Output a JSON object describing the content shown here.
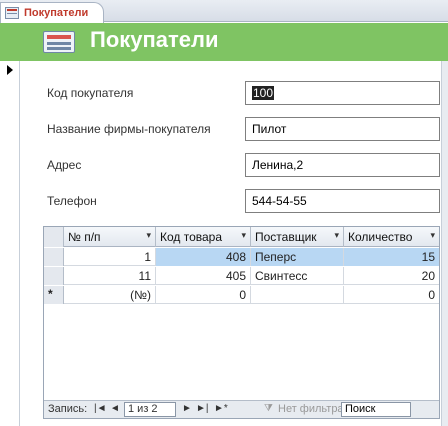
{
  "tab": {
    "label": "Покупатели",
    "icon": "form-icon"
  },
  "header": {
    "title": "Покупатели",
    "icon": "form-icon"
  },
  "fields": [
    {
      "label": "Код покупателя",
      "value": "100"
    },
    {
      "label": "Название фирмы-покупателя",
      "value": "Пилот"
    },
    {
      "label": "Адрес",
      "value": "Ленина,2"
    },
    {
      "label": "Телефон",
      "value": "544-54-55"
    }
  ],
  "subform": {
    "columns": [
      "№ п/п",
      "Код товара",
      "Поставщик",
      "Количество"
    ],
    "rows": [
      {
        "num": "1",
        "code": "408",
        "supplier": "Пеперс",
        "qty": "15"
      },
      {
        "num": "11",
        "code": "405",
        "supplier": "Свинтесс",
        "qty": "20"
      },
      {
        "num": "(№)",
        "code": "0",
        "supplier": "",
        "qty": "0"
      }
    ],
    "new_row_marker": "*"
  },
  "navigation": {
    "record_label": "Запись:",
    "first": "|◄",
    "prev": "◄",
    "position": "1 из 2",
    "next": "►",
    "last": "►|",
    "new": "►*",
    "filter": "Нет фильтра",
    "search": "Поиск"
  }
}
